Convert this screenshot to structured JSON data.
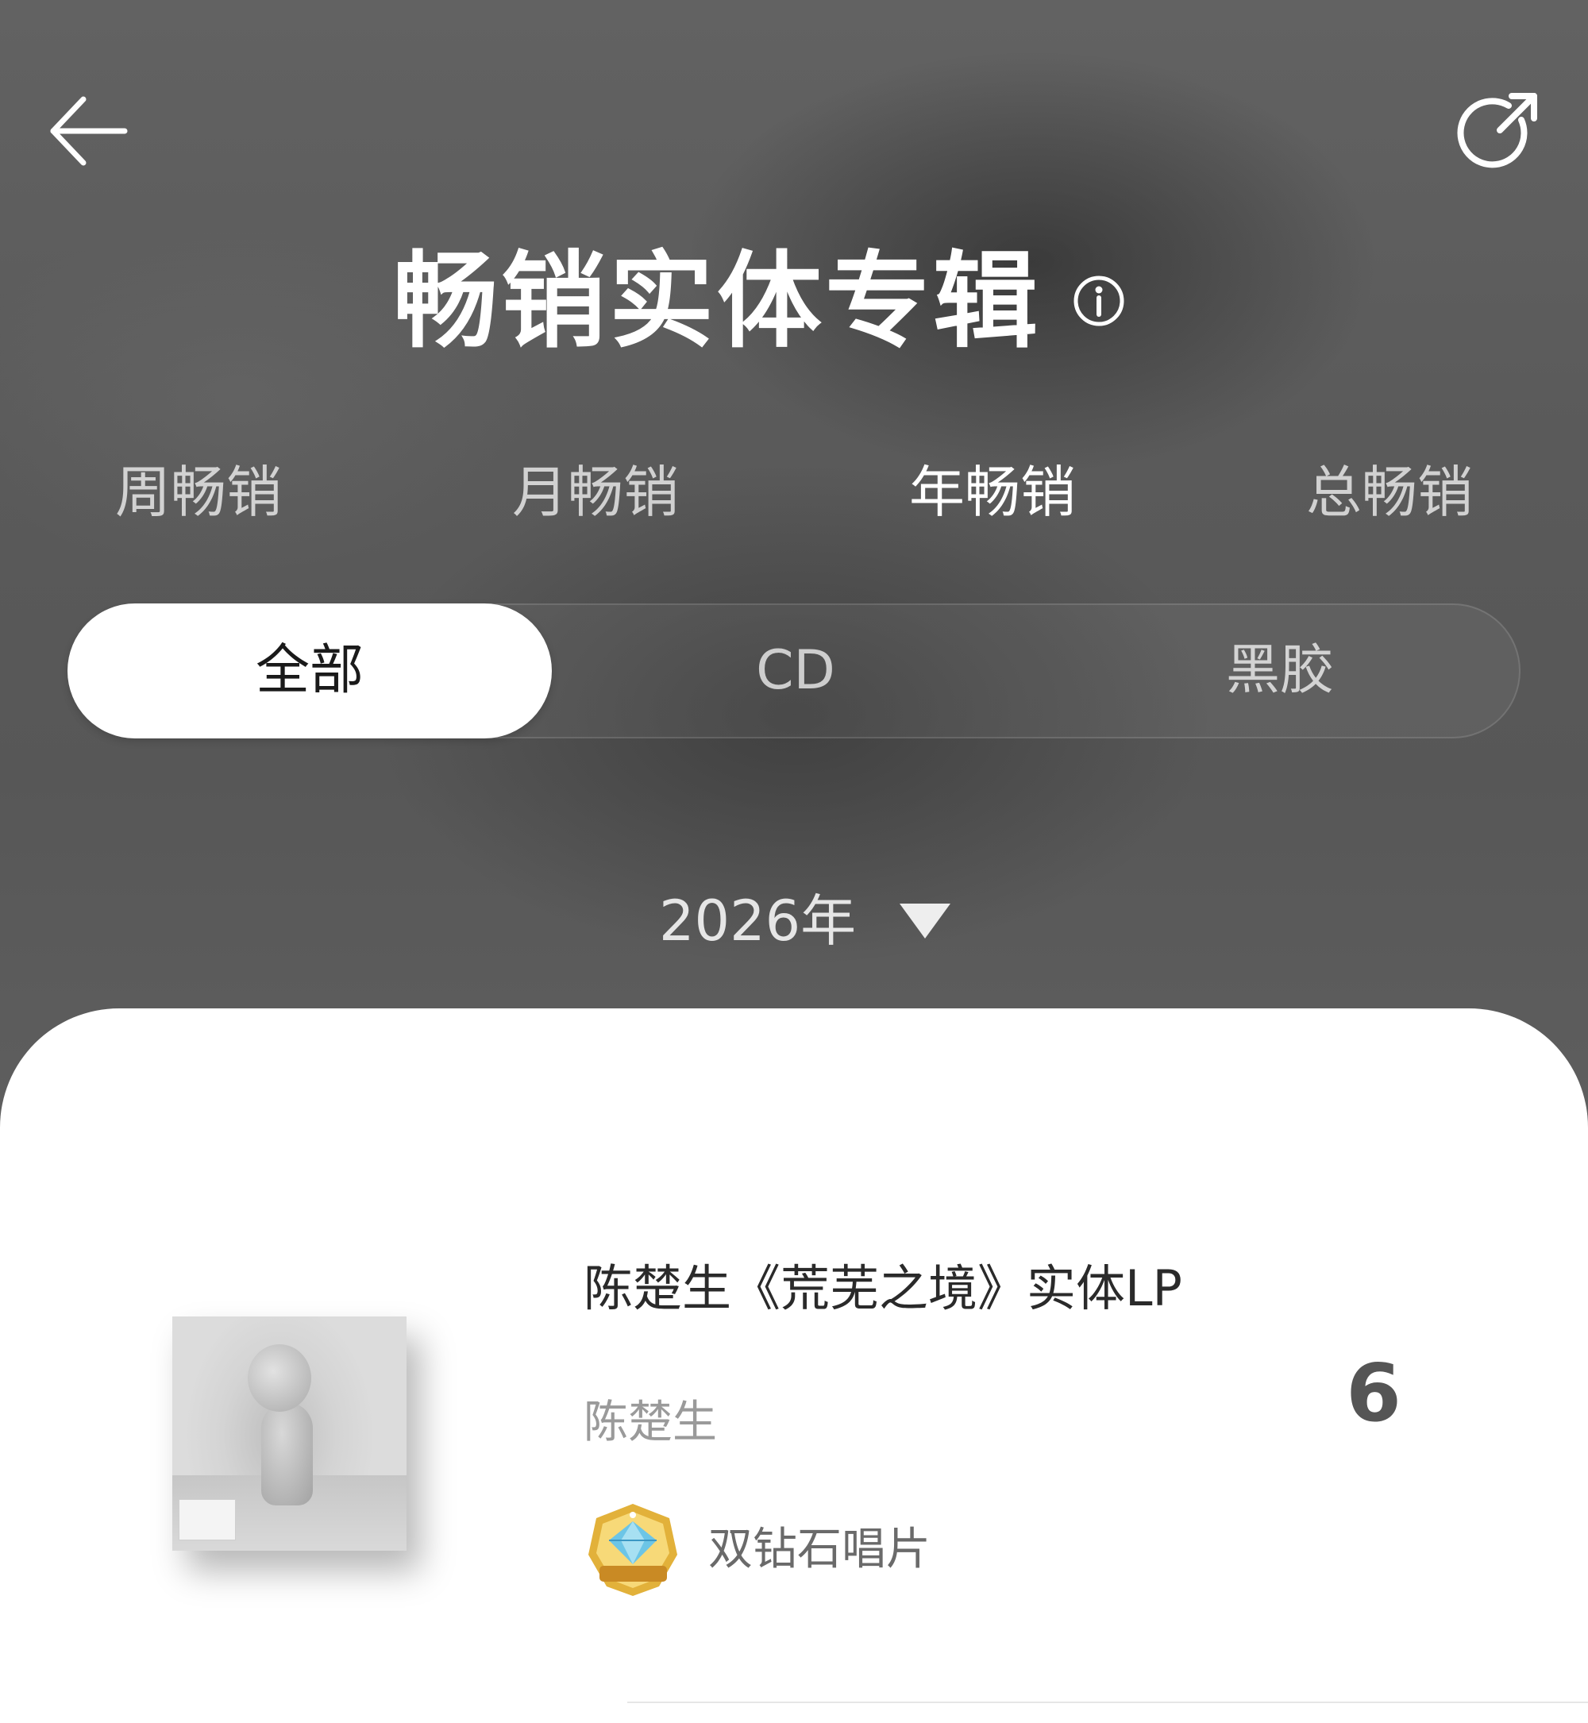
{
  "header": {
    "back_icon": "arrow-left-icon",
    "share_icon": "share-icon",
    "title": "畅销实体专辑",
    "info_icon": "info-icon"
  },
  "period_tabs": [
    {
      "label": "周畅销",
      "active": false
    },
    {
      "label": "月畅销",
      "active": false
    },
    {
      "label": "年畅销",
      "active": true
    },
    {
      "label": "总畅销",
      "active": false
    }
  ],
  "format_filter": [
    {
      "label": "全部",
      "active": true
    },
    {
      "label": "CD",
      "active": false
    },
    {
      "label": "黑胶",
      "active": false
    }
  ],
  "year_select": {
    "value": "2026年",
    "caret_icon": "triangle-down-icon"
  },
  "albums": [
    {
      "title": "陈楚生《荒芜之境》实体LP",
      "artist": "陈楚生",
      "rank": "6",
      "badge_label": "双钻石唱片",
      "badge_icon": "double-diamond-badge-icon"
    }
  ],
  "colors": {
    "header_bg": "#5c5c5c",
    "sheet_bg": "#ffffff",
    "active_text": "#ffffff",
    "inactive_text": "#cfcfcf",
    "segment_active_bg": "#ffffff",
    "rank_color": "#555555"
  }
}
